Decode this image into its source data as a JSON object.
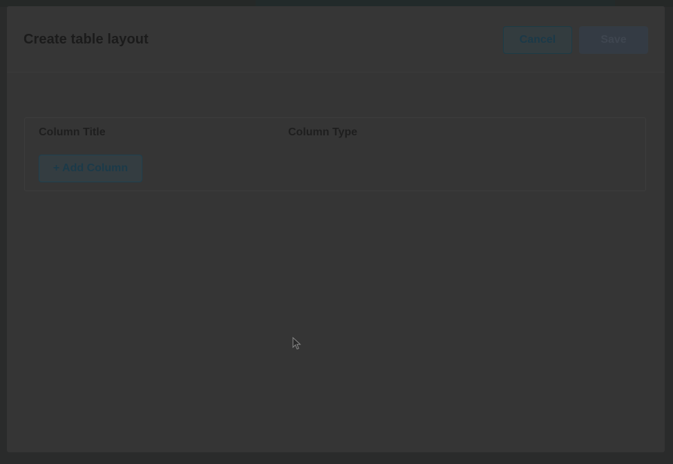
{
  "modal": {
    "title": "Create table layout",
    "cancel_label": "Cancel",
    "save_label": "Save"
  },
  "columns_table": {
    "headers": [
      "Column Title",
      "Column Type"
    ],
    "add_column_label": "+ Add Column"
  },
  "colors": {
    "overlay": "#2a2b2b",
    "modal_bg": "#353535",
    "title_text": "#1b1b1b",
    "accent_text": "#1b3948"
  },
  "icons": {
    "cursor": "mouse-pointer-icon"
  }
}
